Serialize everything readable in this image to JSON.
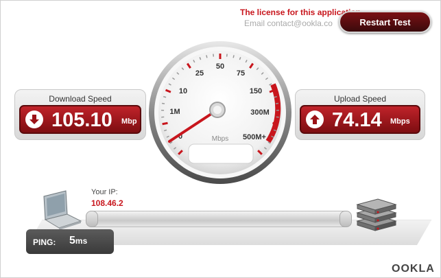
{
  "notice": {
    "license": "The license for this application",
    "email": "Email contact@ookla.co"
  },
  "toolbar": {
    "restart_label": "Restart Test"
  },
  "download": {
    "label": "Download Speed",
    "value": "105.10",
    "unit": "Mbp"
  },
  "upload": {
    "label": "Upload Speed",
    "value": "74.14",
    "unit": "Mbps"
  },
  "gauge": {
    "scale_labels": [
      "0",
      "1M",
      "10",
      "25",
      "50",
      "75",
      "150",
      "300M",
      "500M+"
    ],
    "unit_label": "Mbps"
  },
  "client": {
    "ip_label": "Your IP:",
    "ip_value": "108.46.2"
  },
  "ping": {
    "label": "PING:",
    "value": "5",
    "unit": "ms"
  },
  "brand": {
    "logo": "OOKLA"
  },
  "colors": {
    "accent": "#c8161d",
    "dark_red": "#7d0d11",
    "panel_gray": "#d8d8d8"
  },
  "icons": {
    "download": "arrow-down-icon",
    "upload": "arrow-up-icon",
    "computer": "computer-icon",
    "server": "server-icon"
  }
}
